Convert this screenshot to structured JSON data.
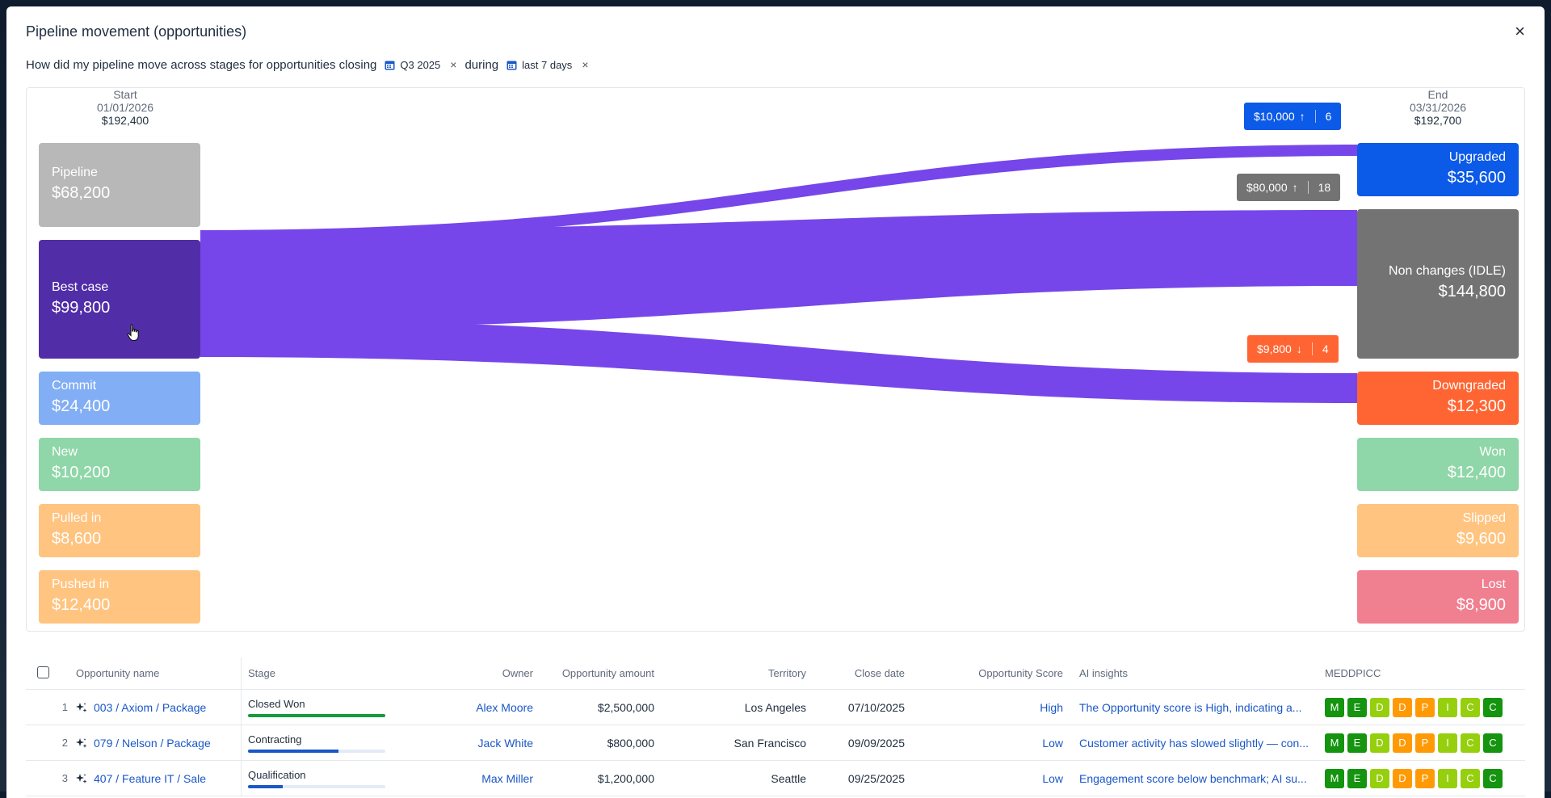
{
  "modal": {
    "title": "Pipeline movement (opportunities)",
    "close_label": "×"
  },
  "question": {
    "prefix": "How did my pipeline move across stages for opportunities closing",
    "chip1": "Q3 2025",
    "middle": "during",
    "chip2": "last 7 days",
    "chip_remove": "×"
  },
  "sankey": {
    "start": {
      "label": "Start",
      "date": "01/01/2026",
      "total": "$192,400"
    },
    "end": {
      "label": "End",
      "date": "03/31/2026",
      "total": "$192,700"
    },
    "left_nodes": [
      {
        "label": "Pipeline",
        "value": "$68,200",
        "color": "#b8b8b8"
      },
      {
        "label": "Best case",
        "value": "$99,800",
        "color": "#512da8"
      },
      {
        "label": "Commit",
        "value": "$24,400",
        "color": "#82aef5"
      },
      {
        "label": "New",
        "value": "$10,200",
        "color": "#8fd6a8"
      },
      {
        "label": "Pulled in",
        "value": "$8,600",
        "color": "#ffc480"
      },
      {
        "label": "Pushed in",
        "value": "$12,400",
        "color": "#ffc480"
      }
    ],
    "right_nodes": [
      {
        "label": "Upgraded",
        "value": "$35,600",
        "color": "#0b5ae8"
      },
      {
        "label": "Non changes (IDLE)",
        "value": "$144,800",
        "color": "#737373"
      },
      {
        "label": "Downgraded",
        "value": "$12,300",
        "color": "#ff6533"
      },
      {
        "label": "Won",
        "value": "$12,400",
        "color": "#8fd6a8"
      },
      {
        "label": "Slipped",
        "value": "$9,600",
        "color": "#ffc480"
      },
      {
        "label": "Lost",
        "value": "$8,900",
        "color": "#f07f90"
      }
    ],
    "flow_color": "#7646ea",
    "badges": [
      {
        "amount": "$10,000",
        "arrow": "↑",
        "count": "6",
        "color": "#0b5ae8"
      },
      {
        "amount": "$80,000",
        "arrow": "↑",
        "count": "18",
        "color": "#737373"
      },
      {
        "amount": "$9,800",
        "arrow": "↓",
        "count": "4",
        "color": "#ff6533"
      }
    ]
  },
  "table": {
    "columns": {
      "name": "Opportunity name",
      "stage": "Stage",
      "owner": "Owner",
      "amount": "Opportunity amount",
      "territory": "Territory",
      "close_date": "Close date",
      "score": "Opportunity Score",
      "ai": "AI insights",
      "meddpicc": "MEDDPICC"
    },
    "rows": [
      {
        "num": "1",
        "name": "003 / Axiom / Package",
        "stage": "Closed Won",
        "stage_progress": 1.0,
        "stage_color": "#169c3c",
        "owner": "Alex Moore",
        "amount": "$2,500,000",
        "territory": "Los Angeles",
        "close_date": "07/10/2025",
        "score": "High",
        "ai": "The Opportunity score is High, indicating a..."
      },
      {
        "num": "2",
        "name": "079 / Nelson / Package",
        "stage": "Contracting",
        "stage_progress": 0.66,
        "stage_color": "#1a57c7",
        "owner": "Jack White",
        "amount": "$800,000",
        "territory": "San Francisco",
        "close_date": "09/09/2025",
        "score": "Low",
        "ai": "Customer activity has slowed slightly — con..."
      },
      {
        "num": "3",
        "name": "407 / Feature IT / Sale",
        "stage": "Qualification",
        "stage_progress": 0.25,
        "stage_color": "#1a57c7",
        "owner": "Max Miller",
        "amount": "$1,200,000",
        "territory": "Seattle",
        "close_date": "09/25/2025",
        "score": "Low",
        "ai": "Engagement score below benchmark; AI su..."
      }
    ],
    "meddpicc": [
      {
        "letter": "M",
        "color": "#14940f"
      },
      {
        "letter": "E",
        "color": "#14940f"
      },
      {
        "letter": "D",
        "color": "#96cf0e"
      },
      {
        "letter": "D",
        "color": "#ff9a05"
      },
      {
        "letter": "P",
        "color": "#ff9a05"
      },
      {
        "letter": "I",
        "color": "#96cf0e"
      },
      {
        "letter": "C",
        "color": "#96cf0e"
      },
      {
        "letter": "C",
        "color": "#14940f"
      }
    ]
  }
}
